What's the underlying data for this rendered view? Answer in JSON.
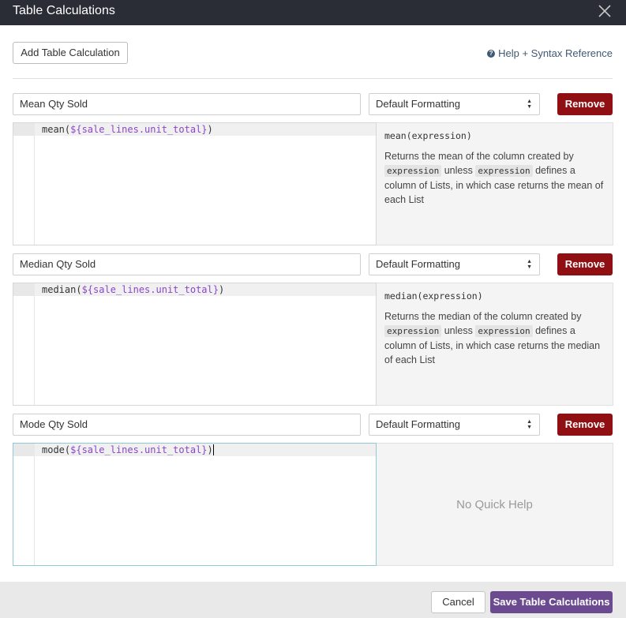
{
  "dialog": {
    "title": "Table Calculations",
    "close_icon": "close-icon"
  },
  "toolbar": {
    "add_label": "Add Table Calculation",
    "help_label": "Help + Syntax Reference",
    "help_icon": "question-circle-icon"
  },
  "calculations": [
    {
      "name": "Mean Qty Sold",
      "formatting": "Default Formatting",
      "remove_label": "Remove",
      "code_fn": "mean(",
      "code_field": "${sale_lines.unit_total}",
      "code_close": ")",
      "help_signature": "mean(expression)",
      "help_pre": "Returns the mean of the column created by",
      "help_code1": "expression",
      "help_mid": "unless",
      "help_code2": "expression",
      "help_post1": "defines a column of Lists, in which case returns the mean of each List"
    },
    {
      "name": "Median Qty Sold",
      "formatting": "Default Formatting",
      "remove_label": "Remove",
      "code_fn": "median(",
      "code_field": "${sale_lines.unit_total}",
      "code_close": ")",
      "help_signature": "median(expression)",
      "help_pre": "Returns the median of the column created by",
      "help_code1": "expression",
      "help_mid": "unless",
      "help_code2": "expression",
      "help_post1": "defines a column of Lists, in which case returns the median of each List"
    },
    {
      "name": "Mode Qty Sold",
      "formatting": "Default Formatting",
      "remove_label": "Remove",
      "code_fn": "mode(",
      "code_field": "${sale_lines.unit_total}",
      "code_close": ")",
      "help_empty": "No Quick Help"
    }
  ],
  "footer": {
    "cancel_label": "Cancel",
    "save_label": "Save Table Calculations"
  },
  "colors": {
    "titlebar": "#2a2c36",
    "remove": "#8f0f12",
    "save": "#6b4a8f",
    "field": "#8a47c7",
    "link": "#3f5a73"
  }
}
